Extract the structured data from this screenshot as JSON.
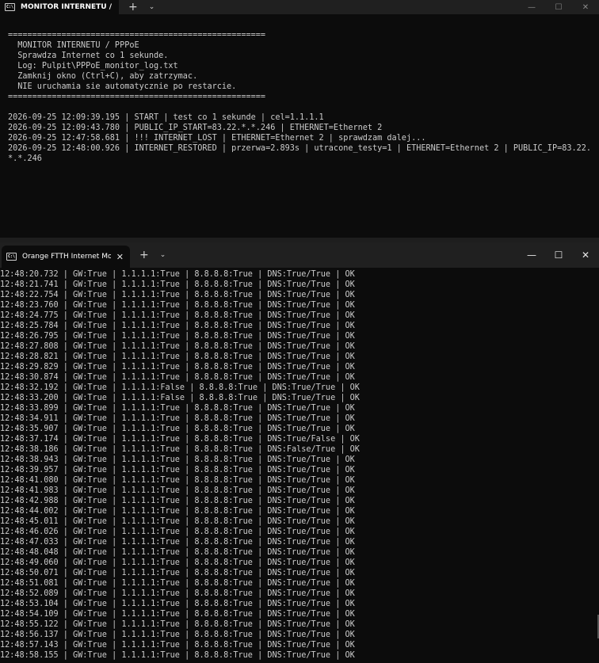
{
  "window_top": {
    "tab_title": "MONITOR INTERNETU / PPPo",
    "lines": [
      "=====================================================",
      "  MONITOR INTERNETU / PPPoE",
      "  Sprawdza Internet co 1 sekunde.",
      "  Log: Pulpit\\PPPoE_monitor_log.txt",
      "  Zamknij okno (Ctrl+C), aby zatrzymac.",
      "  NIE uruchamia sie automatycznie po restarcie.",
      "=====================================================",
      "",
      "2026-09-25 12:09:39.195 | START | test co 1 sekunde | cel=1.1.1.1",
      "2026-09-25 12:09:43.780 | PUBLIC_IP_START=83.22.*.*.246 | ETHERNET=Ethernet 2",
      "2026-09-25 12:47:58.681 | !!! INTERNET_LOST | ETHERNET=Ethernet 2 | sprawdzam dalej...",
      "2026-09-25 12:48:00.926 | INTERNET_RESTORED | przerwa=2.893s | utracone_testy=1 | ETHERNET=Ethernet 2 | PUBLIC_IP=83.22.",
      "*.*.246"
    ]
  },
  "window_bottom": {
    "tab_title": "Orange FTTH Internet Monito",
    "lines": [
      "12:48:20.732 | GW:True | 1.1.1.1:True | 8.8.8.8:True | DNS:True/True | OK",
      "12:48:21.741 | GW:True | 1.1.1.1:True | 8.8.8.8:True | DNS:True/True | OK",
      "12:48:22.754 | GW:True | 1.1.1.1:True | 8.8.8.8:True | DNS:True/True | OK",
      "12:48:23.760 | GW:True | 1.1.1.1:True | 8.8.8.8:True | DNS:True/True | OK",
      "12:48:24.775 | GW:True | 1.1.1.1:True | 8.8.8.8:True | DNS:True/True | OK",
      "12:48:25.784 | GW:True | 1.1.1.1:True | 8.8.8.8:True | DNS:True/True | OK",
      "12:48:26.795 | GW:True | 1.1.1.1:True | 8.8.8.8:True | DNS:True/True | OK",
      "12:48:27.808 | GW:True | 1.1.1.1:True | 8.8.8.8:True | DNS:True/True | OK",
      "12:48:28.821 | GW:True | 1.1.1.1:True | 8.8.8.8:True | DNS:True/True | OK",
      "12:48:29.829 | GW:True | 1.1.1.1:True | 8.8.8.8:True | DNS:True/True | OK",
      "12:48:30.874 | GW:True | 1.1.1.1:True | 8.8.8.8:True | DNS:True/True | OK",
      "12:48:32.192 | GW:True | 1.1.1.1:False | 8.8.8.8:True | DNS:True/True | OK",
      "12:48:33.200 | GW:True | 1.1.1.1:False | 8.8.8.8:True | DNS:True/True | OK",
      "12:48:33.899 | GW:True | 1.1.1.1:True | 8.8.8.8:True | DNS:True/True | OK",
      "12:48:34.911 | GW:True | 1.1.1.1:True | 8.8.8.8:True | DNS:True/True | OK",
      "12:48:35.907 | GW:True | 1.1.1.1:True | 8.8.8.8:True | DNS:True/True | OK",
      "12:48:37.174 | GW:True | 1.1.1.1:True | 8.8.8.8:True | DNS:True/False | OK",
      "12:48:38.186 | GW:True | 1.1.1.1:True | 8.8.8.8:True | DNS:False/True | OK",
      "12:48:38.943 | GW:True | 1.1.1.1:True | 8.8.8.8:True | DNS:True/True | OK",
      "12:48:39.957 | GW:True | 1.1.1.1:True | 8.8.8.8:True | DNS:True/True | OK",
      "12:48:41.080 | GW:True | 1.1.1.1:True | 8.8.8.8:True | DNS:True/True | OK",
      "12:48:41.983 | GW:True | 1.1.1.1:True | 8.8.8.8:True | DNS:True/True | OK",
      "12:48:42.988 | GW:True | 1.1.1.1:True | 8.8.8.8:True | DNS:True/True | OK",
      "12:48:44.002 | GW:True | 1.1.1.1:True | 8.8.8.8:True | DNS:True/True | OK",
      "12:48:45.011 | GW:True | 1.1.1.1:True | 8.8.8.8:True | DNS:True/True | OK",
      "12:48:46.026 | GW:True | 1.1.1.1:True | 8.8.8.8:True | DNS:True/True | OK",
      "12:48:47.033 | GW:True | 1.1.1.1:True | 8.8.8.8:True | DNS:True/True | OK",
      "12:48:48.048 | GW:True | 1.1.1.1:True | 8.8.8.8:True | DNS:True/True | OK",
      "12:48:49.060 | GW:True | 1.1.1.1:True | 8.8.8.8:True | DNS:True/True | OK",
      "12:48:50.071 | GW:True | 1.1.1.1:True | 8.8.8.8:True | DNS:True/True | OK",
      "12:48:51.081 | GW:True | 1.1.1.1:True | 8.8.8.8:True | DNS:True/True | OK",
      "12:48:52.089 | GW:True | 1.1.1.1:True | 8.8.8.8:True | DNS:True/True | OK",
      "12:48:53.104 | GW:True | 1.1.1.1:True | 8.8.8.8:True | DNS:True/True | OK",
      "12:48:54.109 | GW:True | 1.1.1.1:True | 8.8.8.8:True | DNS:True/True | OK",
      "12:48:55.122 | GW:True | 1.1.1.1:True | 8.8.8.8:True | DNS:True/True | OK",
      "12:48:56.137 | GW:True | 1.1.1.1:True | 8.8.8.8:True | DNS:True/True | OK",
      "12:48:57.143 | GW:True | 1.1.1.1:True | 8.8.8.8:True | DNS:True/True | OK",
      "12:48:58.155 | GW:True | 1.1.1.1:True | 8.8.8.8:True | DNS:True/True | OK"
    ]
  },
  "ui": {
    "tab_icon_text": "C:\\",
    "close_glyph": "✕",
    "plus_glyph": "+",
    "chevron_glyph": "⌄",
    "minimize_glyph": "—",
    "maximize_glyph": "☐",
    "window_close_glyph": "✕"
  }
}
